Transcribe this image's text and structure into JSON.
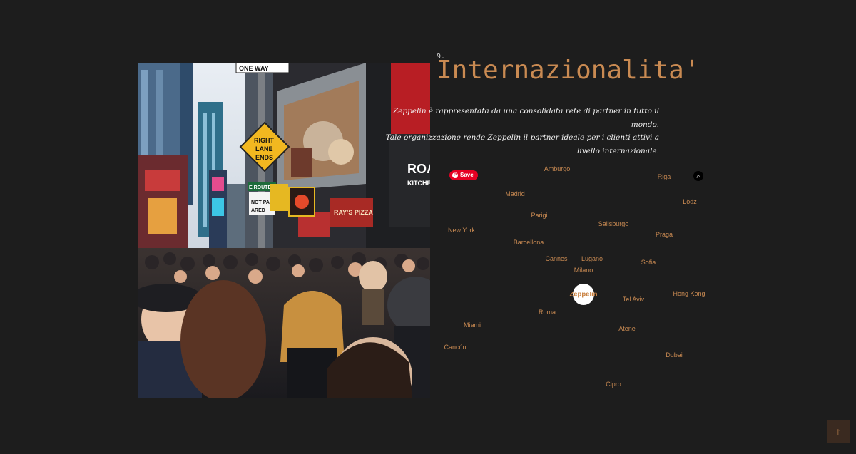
{
  "section": {
    "number": "9.",
    "title": "Internazionalita'",
    "intro_line1": "Zeppelin è rappresentata da una consolidata rete di partner in tutto il mondo.",
    "intro_line2": "Tale organizzazione rende Zeppelin il partner ideale per i clienti attivi a livello internazionale."
  },
  "photo": {
    "sign_one_way": "ONE WAY",
    "sign_right_lane_1": "RIGHT",
    "sign_right_lane_2": "LANE",
    "sign_right_lane_3": "ENDS",
    "sign_route": "E ROUTE",
    "sign_not_parked_1": "NOT PA",
    "sign_not_parked_2": "ARED",
    "store_rays": "RAY'S PIZZA",
    "store_roast_1": "ROAS",
    "store_roast_2": "KITCHEN"
  },
  "overlay": {
    "pinterest_save": "Save",
    "lens_icon": "lens-icon"
  },
  "network": {
    "hub": "Zeppelin",
    "cities": [
      "Amburgo",
      "Riga",
      "Madrid",
      "Lòdz",
      "Parigi",
      "Salisburgo",
      "New York",
      "Praga",
      "Barcellona",
      "Cannes",
      "Lugano",
      "Sofia",
      "Milano",
      "Hong Kong",
      "Tel Aviv",
      "Roma",
      "Miami",
      "Atene",
      "Cancún",
      "Dubai",
      "Cipro"
    ]
  },
  "back_to_top": "↑",
  "colors": {
    "background": "#1d1d1d",
    "accent": "#c98a52",
    "text": "#f2f2f2"
  }
}
